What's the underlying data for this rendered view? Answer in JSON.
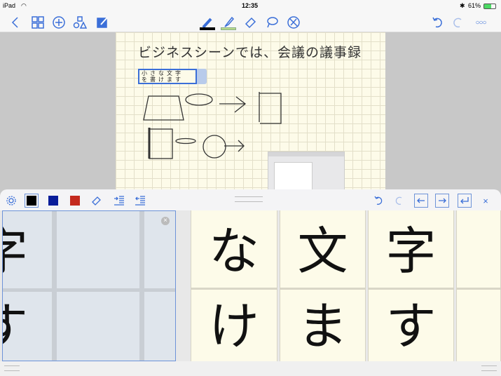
{
  "status": {
    "device": "iPad",
    "time": "12:35",
    "battery": "61%"
  },
  "toolbar": {
    "left_icons": [
      "back-icon",
      "pages-grid-icon",
      "add-icon",
      "shapes-icon",
      "edit-note-icon"
    ],
    "center_icons": [
      "pen-icon",
      "highlighter-icon",
      "eraser-icon",
      "lasso-icon",
      "disable-pen-icon"
    ],
    "right_icons": [
      "undo-icon",
      "redo-icon",
      "more-icon"
    ],
    "pen_color": "#000000",
    "highlighter_color": "#b9dc8a"
  },
  "note": {
    "heading": "ビジネスシーンでは、会議の議事録",
    "small_text_line1": "小さな文字",
    "small_text_line2": "を書けます"
  },
  "panel": {
    "colors": [
      "#000000",
      "#0a1e9a",
      "#c42a1e"
    ],
    "selected_color": "#000000",
    "left_glyphs": [
      "字",
      "す"
    ],
    "cells": [
      {
        "top": "な",
        "bottom": "け"
      },
      {
        "top": "文",
        "bottom": "ま"
      },
      {
        "top": "字",
        "bottom": "す"
      }
    ]
  }
}
